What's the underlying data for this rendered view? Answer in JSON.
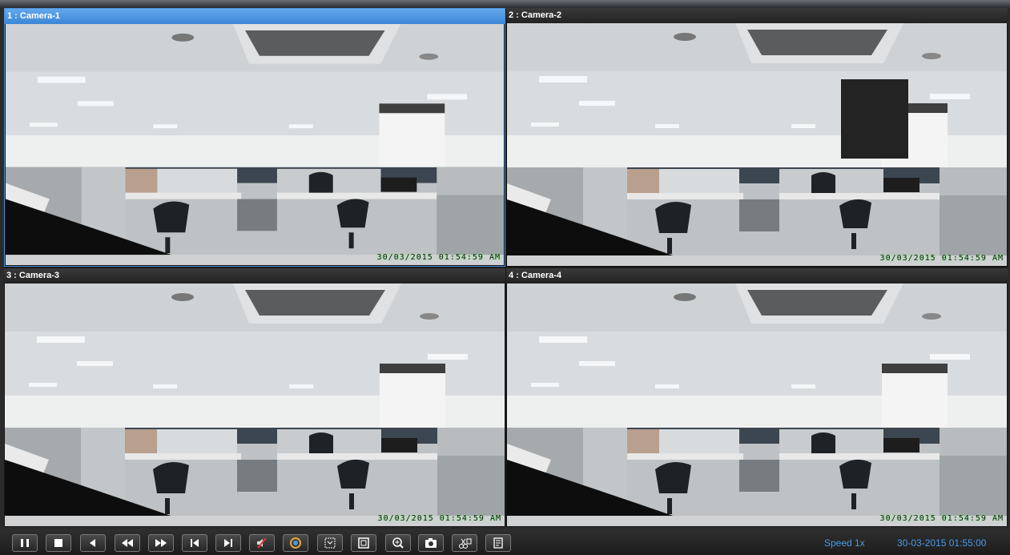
{
  "panes": [
    {
      "title": "1 : Camera-1",
      "timestamp": "30/03/2015 01:54:59 AM"
    },
    {
      "title": "2 : Camera-2",
      "timestamp": "30/03/2015 01:54:59 AM"
    },
    {
      "title": "3 : Camera-3",
      "timestamp": "30/03/2015 01:54:59 AM"
    },
    {
      "title": "4 : Camera-4",
      "timestamp": "30/03/2015 01:54:59 AM"
    }
  ],
  "toolbar": {
    "buttons": [
      "pause-icon",
      "stop-icon",
      "step-back-icon",
      "rewind-icon",
      "fast-forward-icon",
      "skip-start-icon",
      "skip-end-icon",
      "mute-icon",
      "color-adjust-icon",
      "fit-screen-icon",
      "fullscreen-icon",
      "zoom-in-icon",
      "snapshot-icon",
      "clip-export-icon",
      "notes-icon"
    ],
    "speed": "Speed  1x",
    "datetime": "30-03-2015  01:55:00"
  },
  "colors": {
    "active_accent": "#4a90d9",
    "status_text": "#4a9ae6",
    "timestamp_glow": "#7ff07f"
  }
}
